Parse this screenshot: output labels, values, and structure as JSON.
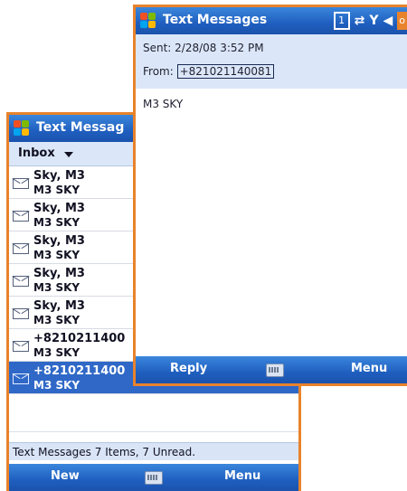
{
  "colors": {
    "accent": "#e8832c",
    "titlebar": "#1f5fbf",
    "selection": "#2f68c7"
  },
  "back_window": {
    "title": "Text Messag",
    "folder": "Inbox",
    "messages": [
      {
        "sender": "Sky, M3",
        "preview": "M3 SKY",
        "selected": false
      },
      {
        "sender": "Sky, M3",
        "preview": "M3 SKY",
        "selected": false
      },
      {
        "sender": "Sky, M3",
        "preview": "M3 SKY",
        "selected": false
      },
      {
        "sender": "Sky, M3",
        "preview": "M3 SKY",
        "selected": false
      },
      {
        "sender": "Sky, M3",
        "preview": "M3 SKY",
        "selected": false
      },
      {
        "sender": "+8210211400",
        "preview": "M3 SKY",
        "selected": false
      },
      {
        "sender": "+8210211400",
        "preview": "M3 SKY",
        "selected": true
      }
    ],
    "status": "Text Messages 7 Items, 7 Unread.",
    "left_soft": "New",
    "right_soft": "Menu"
  },
  "front_window": {
    "title": "Text Messages",
    "status_box": "1",
    "ok_label": "o",
    "sent": "Sent: 2/28/08 3:52 PM",
    "from_label": "From:",
    "from_value": "+821021140081",
    "body": "M3 SKY",
    "left_soft": "Reply",
    "right_soft": "Menu"
  }
}
